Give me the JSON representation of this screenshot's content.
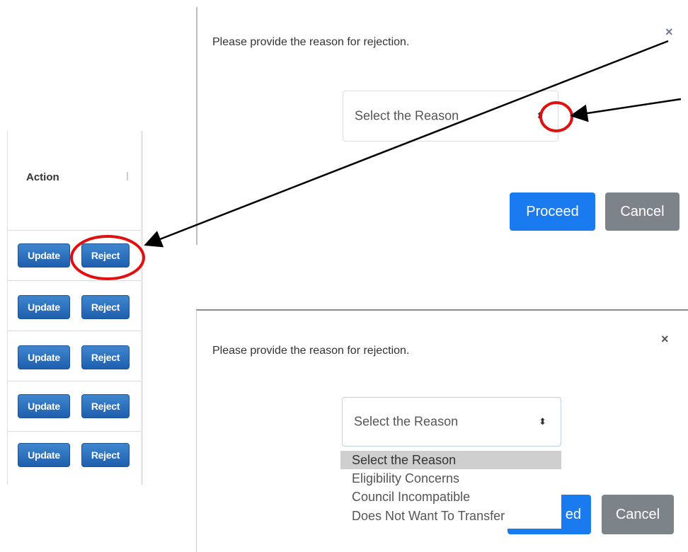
{
  "action_table": {
    "header": "Action",
    "rows": [
      {
        "update": "Update",
        "reject": "Reject"
      },
      {
        "update": "Update",
        "reject": "Reject"
      },
      {
        "update": "Update",
        "reject": "Reject"
      },
      {
        "update": "Update",
        "reject": "Reject"
      },
      {
        "update": "Update",
        "reject": "Reject"
      }
    ]
  },
  "modal_top": {
    "prompt": "Please provide the reason for rejection.",
    "close": "×",
    "select_value": "Select the Reason",
    "select_caret": "⬍",
    "proceed": "Proceed",
    "cancel": "Cancel"
  },
  "modal_bottom": {
    "prompt": "Please provide the reason for rejection.",
    "close": "×",
    "select_value": "Select the Reason",
    "select_caret": "⬍",
    "options": [
      "Select the Reason",
      "Eligibility Concerns",
      "Council Incompatible",
      "Does Not Want To Transfer"
    ],
    "proceed_partial": "ed",
    "cancel": "Cancel"
  },
  "colors": {
    "annotation_red": "#e01010",
    "primary_blue": "#1a7af0",
    "cancel_grey": "#7d8489"
  }
}
